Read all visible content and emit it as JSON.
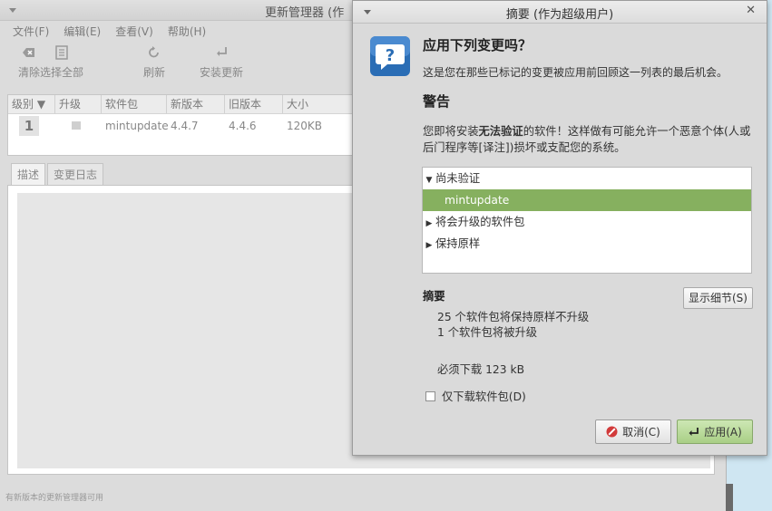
{
  "background_window": {
    "title": "更新管理器 (作",
    "menu": [
      "文件(F)",
      "编辑(E)",
      "查看(V)",
      "帮助(H)"
    ],
    "toolbar": {
      "clear": "清除",
      "select_all": "选择全部",
      "refresh": "刷新",
      "install": "安装更新"
    },
    "table": {
      "columns": [
        "级别 ▼",
        "升级",
        "软件包",
        "新版本",
        "旧版本",
        "大小"
      ],
      "rows": [
        {
          "level": "1",
          "package": "mintupdate",
          "new_version": "4.4.7",
          "old_version": "4.4.6",
          "size": "120KB"
        }
      ]
    },
    "tabs": [
      "描述",
      "变更日志"
    ],
    "status": "有新版本的更新管理器可用"
  },
  "dialog": {
    "title": "摘要 (作为超级用户)",
    "heading": "应用下列变更吗？",
    "subtitle": "这是您在那些已标记的变更被应用前回顾这一列表的最后机会。",
    "warning_title": "警告",
    "warning_pre": "您即将安装",
    "warning_bold": "无法验证",
    "warning_post": "的软件！这样做有可能允许一个恶意个体(人或后门程序等[译注])损坏或支配您的系统。",
    "tree": {
      "unverified": "尚未验证",
      "unverified_child": "mintupdate",
      "to_upgrade": "将会升级的软件包",
      "keep": "保持原样"
    },
    "summary_title": "摘要",
    "details_button": "显示细节(S)",
    "summary_lines": {
      "kept": "25 个软件包将保持原样不升级",
      "upgraded": "1 个软件包将被升级",
      "download": "必须下载 123 kB"
    },
    "download_only_label": "仅下载软件包(D)",
    "cancel_button": "取消(C)",
    "apply_button": "应用(A)"
  },
  "colors": {
    "selection": "#86b05f",
    "apply_button": "#a9cf86",
    "question_icon": "#2a6db5"
  }
}
